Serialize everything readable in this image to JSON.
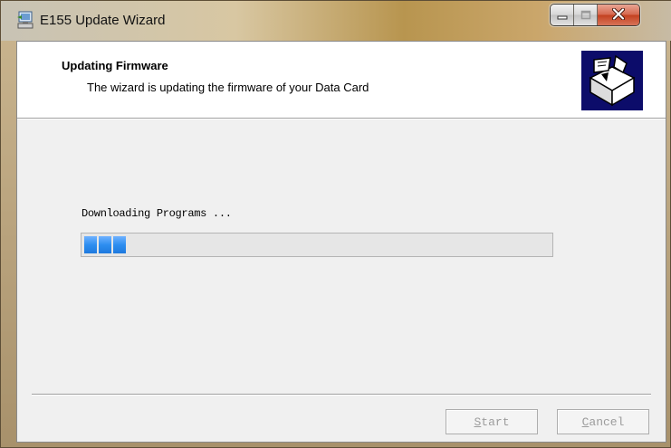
{
  "window": {
    "title": "E155 Update Wizard",
    "icon": "wizard-computer-icon",
    "controls": {
      "minimize_icon": "minimize-icon",
      "maximize_icon": "maximize-icon",
      "close_icon": "close-icon"
    }
  },
  "header": {
    "title": "Updating Firmware",
    "subtitle": "The wizard is updating the firmware of your Data Card",
    "image_icon": "box-software-icon"
  },
  "main": {
    "status_text": "Downloading Programs ...",
    "progress": {
      "filled_chunks": 3
    }
  },
  "footer": {
    "start_label": "Start",
    "cancel_label": "Cancel",
    "buttons_enabled": false
  },
  "colors": {
    "progress_fill": "#2e8ef0",
    "header_image_bg": "#0c0c6a",
    "close_button": "#c3401f"
  }
}
